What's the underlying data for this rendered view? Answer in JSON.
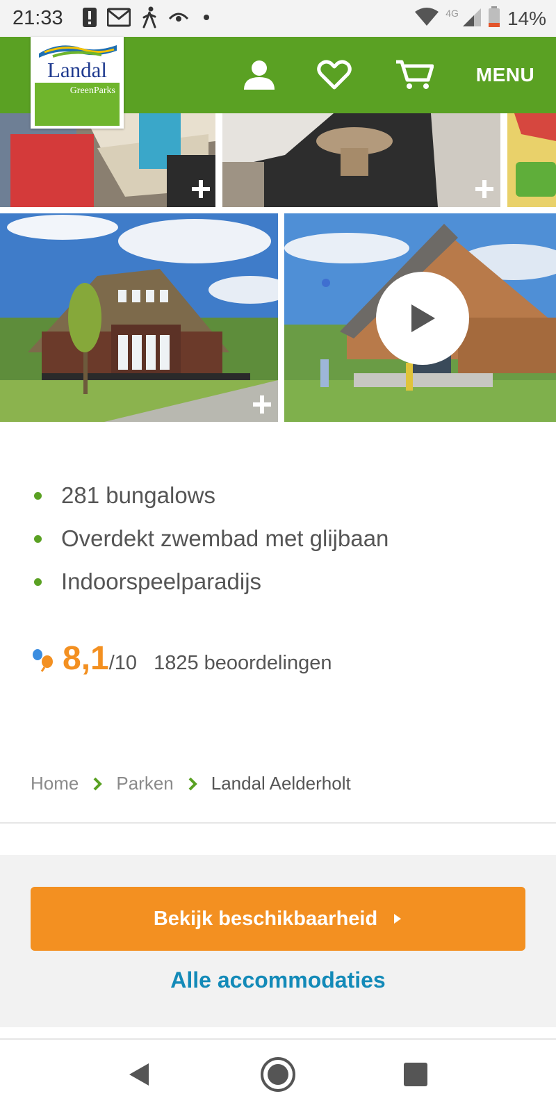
{
  "status_bar": {
    "time": "21:33",
    "network": "4G",
    "battery": "14%",
    "icons": [
      "alert-icon",
      "gmail-icon",
      "walking-icon",
      "eye-icon",
      "dot-icon",
      "wifi-icon",
      "signal-icon",
      "battery-icon"
    ]
  },
  "header": {
    "logo_name": "Landal",
    "logo_sub": "GreenParks",
    "menu_label": "MENU",
    "brand_green": "#5aa123",
    "icons": [
      "user-icon",
      "heart-icon",
      "cart-icon"
    ]
  },
  "features": [
    "281 bungalows",
    "Overdekt zwembad met glijbaan",
    "Indoorspeelparadijs"
  ],
  "rating": {
    "score": "8,1",
    "max": "/10",
    "count": "1825 beoordelingen",
    "accent": "#f39021"
  },
  "breadcrumb": {
    "home": "Home",
    "parks": "Parken",
    "current": "Landal Aelderholt"
  },
  "cta": {
    "availability_label": "Bekijk beschikbaarheid",
    "all_accommodations": "Alle accommodaties",
    "button_color": "#f39021",
    "link_color": "#138ab8"
  },
  "nav": {
    "icons": [
      "back-icon",
      "home-icon",
      "recents-icon"
    ]
  }
}
